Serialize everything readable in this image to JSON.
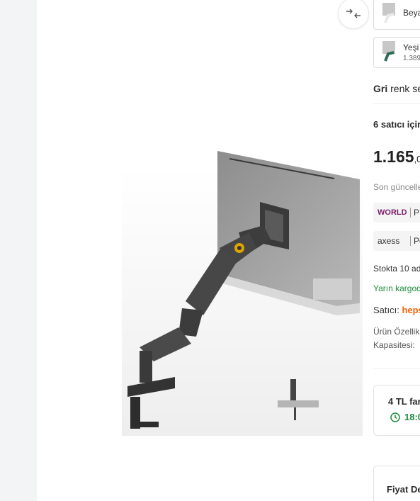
{
  "color_options": [
    {
      "name": "Beya",
      "price": ""
    },
    {
      "name": "Yeşi",
      "price": "1.389"
    }
  ],
  "selected_color": {
    "value": "Gri",
    "suffix": " renk se"
  },
  "sellers_heading": "6 satıcı için",
  "price": {
    "main": "1.165",
    "fraction": ",0"
  },
  "last_update": "Son güncelle",
  "badges": [
    {
      "logo": "WORLD",
      "label": "P",
      "color": "#7a1d6b"
    },
    {
      "logo": "axess",
      "label": "Pe",
      "color": "#333333"
    }
  ],
  "stock_text": "Stokta 10 ad",
  "delivery_text": "Yarın kargod",
  "seller": {
    "label": "Satıcı:",
    "name": "heps"
  },
  "features": {
    "line1": "Ürün Özellik",
    "line2": "Kapasitesi: "
  },
  "shipping_card": {
    "title": "4 TL far",
    "time": "18:0"
  },
  "price_card": {
    "title": "Fiyat De"
  },
  "colors": {
    "green": "#1a8c3a",
    "orange": "#ff6000",
    "world_purple": "#7a1d6b"
  },
  "icons": {
    "gallery_control": "collapse-arrows-icon",
    "clock": "clock-icon"
  }
}
